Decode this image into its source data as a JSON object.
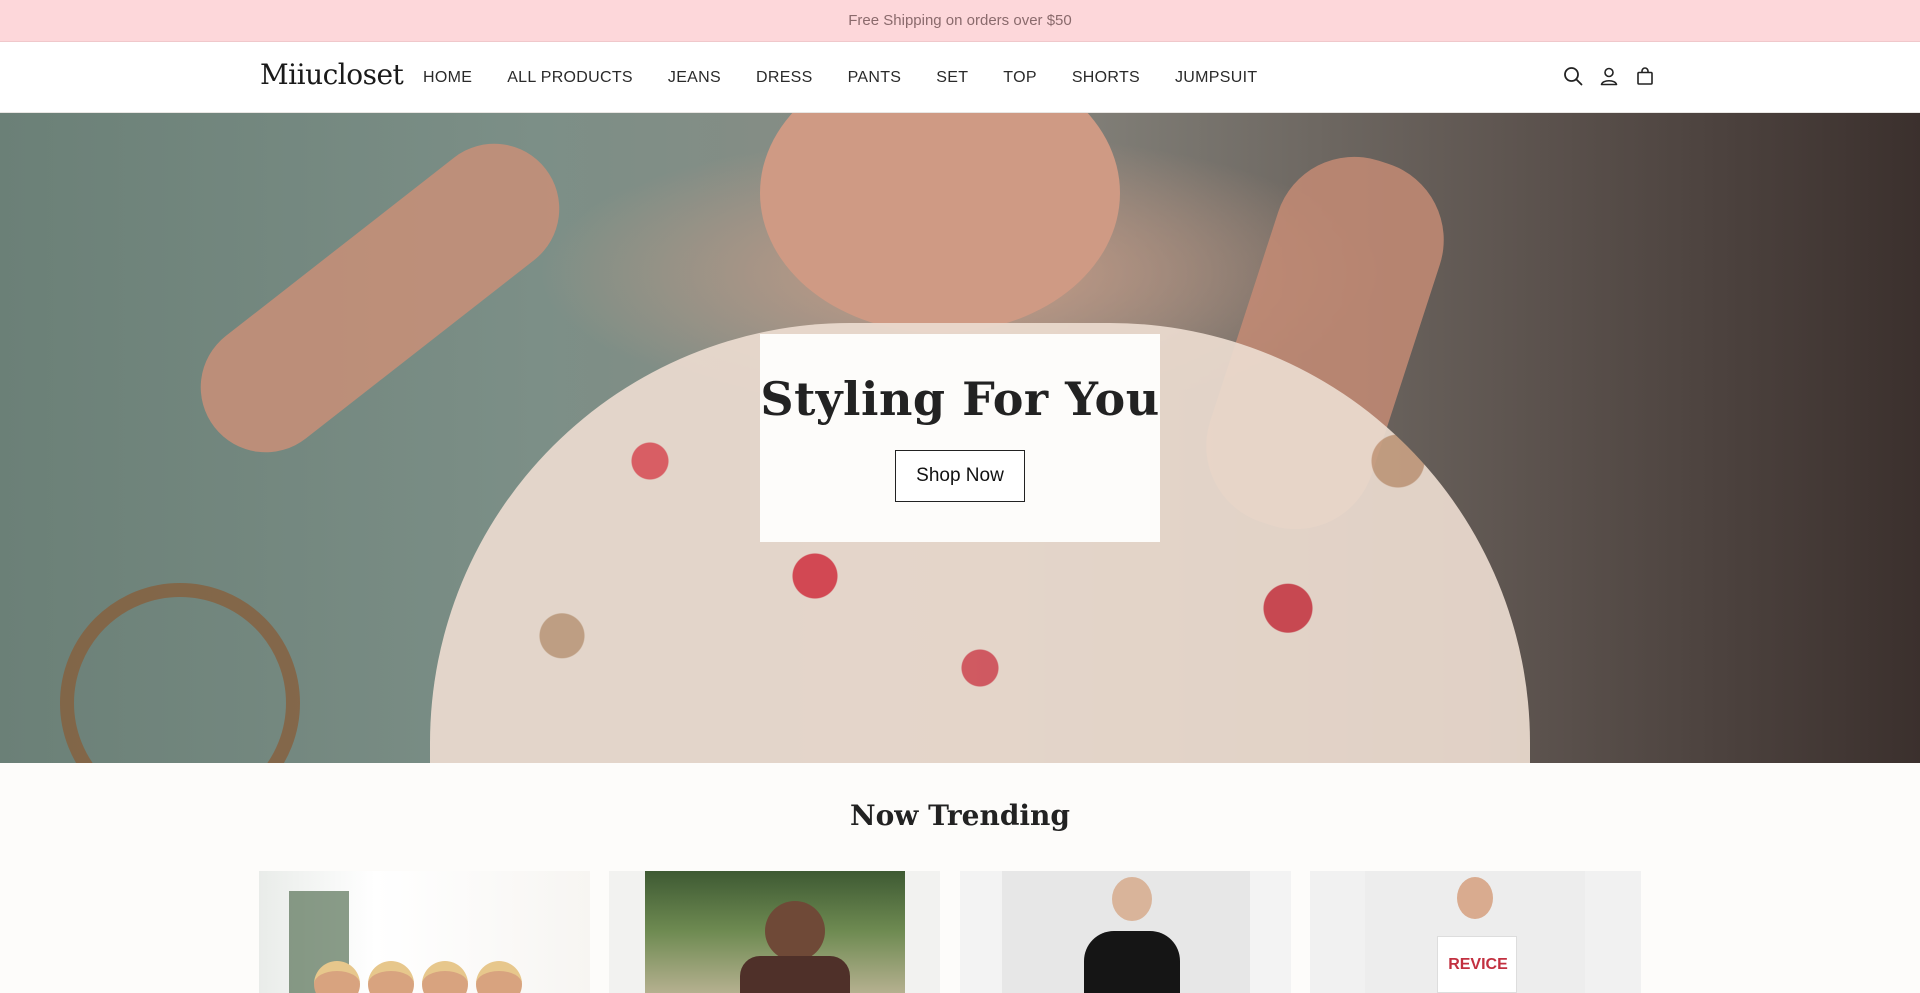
{
  "announcement": {
    "text": "Free Shipping on orders over $50"
  },
  "header": {
    "logo": "Miiucloset",
    "nav": [
      {
        "label": "HOME"
      },
      {
        "label": "ALL PRODUCTS"
      },
      {
        "label": "JEANS"
      },
      {
        "label": "DRESS"
      },
      {
        "label": "PANTS"
      },
      {
        "label": "SET"
      },
      {
        "label": "TOP"
      },
      {
        "label": "SHORTS"
      },
      {
        "label": "JUMPSUIT"
      }
    ],
    "icons": [
      "search-icon",
      "account-icon",
      "cart-icon"
    ]
  },
  "hero": {
    "title": "Styling For You",
    "button_label": "Shop Now"
  },
  "trending": {
    "title": "Now Trending",
    "products": [
      {
        "image": "group-white-outfits"
      },
      {
        "image": "brown-jumpsuit"
      },
      {
        "image": "black-tank-dress"
      },
      {
        "image": "white-sports-top",
        "print": "REVICE"
      }
    ]
  },
  "colors": {
    "announcement_bg": "#fdd7da",
    "page_bg": "#fdfcfa",
    "text": "#1c1c1c"
  }
}
